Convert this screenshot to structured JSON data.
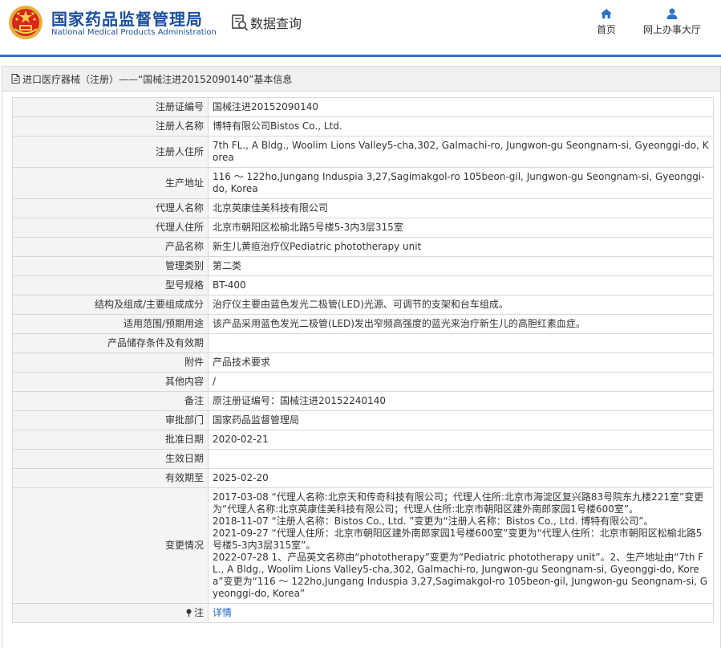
{
  "header": {
    "brand_cn": "国家药品监督管理局",
    "brand_en": "National Medical Products Administration",
    "query_label": "数据查询",
    "nav": [
      {
        "label": "首页",
        "icon": "home-icon"
      },
      {
        "label": "网上办事大厅",
        "icon": "user-icon"
      }
    ],
    "accent_color": "#2d73c4"
  },
  "panel": {
    "title": "进口医疗器械（注册）——“国械注进20152090140”基本信息"
  },
  "fields": [
    {
      "label": "注册证编号",
      "value": "国械注进20152090140"
    },
    {
      "label": "注册人名称",
      "value": "博特有限公司Bistos Co., Ltd."
    },
    {
      "label": "注册人住所",
      "value": "7th FL., A Bldg., Woolim Lions Valley5-cha,302, Galmachi-ro, Jungwon-gu Seongnam-si, Gyeonggi-do, Korea"
    },
    {
      "label": "生产地址",
      "value": "116 ～ 122ho,Jungang Induspia 3,27,Sagimakgol-ro 105beon-gil, Jungwon-gu Seongnam-si, Gyeonggi-do, Korea"
    },
    {
      "label": "代理人名称",
      "value": "北京英康佳美科技有限公司"
    },
    {
      "label": "代理人住所",
      "value": "北京市朝阳区松榆北路5号楼5-3内3层315室"
    },
    {
      "label": "产品名称",
      "value": "新生儿黄疸治疗仪Pediatric phototherapy unit"
    },
    {
      "label": "管理类别",
      "value": "第二类"
    },
    {
      "label": "型号规格",
      "value": "BT-400"
    },
    {
      "label": "结构及组成/主要组成成分",
      "value": "治疗仪主要由蓝色发光二极管(LED)光源、可调节的支架和台车组成。"
    },
    {
      "label": "适用范围/预期用途",
      "value": "该产品采用蓝色发光二极管(LED)发出窄频高强度的蓝光来治疗新生儿的高胆红素血症。"
    },
    {
      "label": "产品储存条件及有效期",
      "value": ""
    },
    {
      "label": "附件",
      "value": "产品技术要求"
    },
    {
      "label": "其他内容",
      "value": "/"
    },
    {
      "label": "备注",
      "value": "原注册证编号：国械注进20152240140"
    },
    {
      "label": "审批部门",
      "value": "国家药品监督管理局"
    },
    {
      "label": "批准日期",
      "value": "2020-02-21"
    },
    {
      "label": "生效日期",
      "value": ""
    },
    {
      "label": "有效期至",
      "value": "2025-02-20"
    }
  ],
  "changes": {
    "label": "变更情况",
    "lines": [
      "2017-03-08 “代理人名称:北京天和传奇科技有限公司；代理人住所:北京市海淀区复兴路83号院东九楼221室”变更为“代理人名称:北京英康佳美科技有限公司；代理人住所:北京市朝阳区建外南郎家园1号楼600室”。",
      "2018-11-07 “注册人名称：Bistos Co., Ltd. ”变更为“注册人名称：Bistos Co., Ltd. 博特有限公司”。",
      "2021-09-27 “代理人住所：北京市朝阳区建外南郎家园1号楼600室”变更为“代理人住所：北京市朝阳区松榆北路5号楼5-3内3层315室”。",
      "2022-07-28 1、产品英文名称由“phototherapy”变更为“Pediatric phototherapy unit”。2、生产地址由“7th FL., A Bldg., Woolim Lions Valley5-cha,302, Galmachi-ro, Jungwon-gu Seongnam-si, Gyeonggi-do, Korea”变更为“116 ～ 122ho,Jungang Induspia 3,27,Sagimakgol-ro 105beon-gil, Jungwon-gu Seongnam-si, Gyeonggi-do, Korea”"
    ]
  },
  "note_row": {
    "label": "注",
    "icon": "pin-icon",
    "link": "详情"
  }
}
